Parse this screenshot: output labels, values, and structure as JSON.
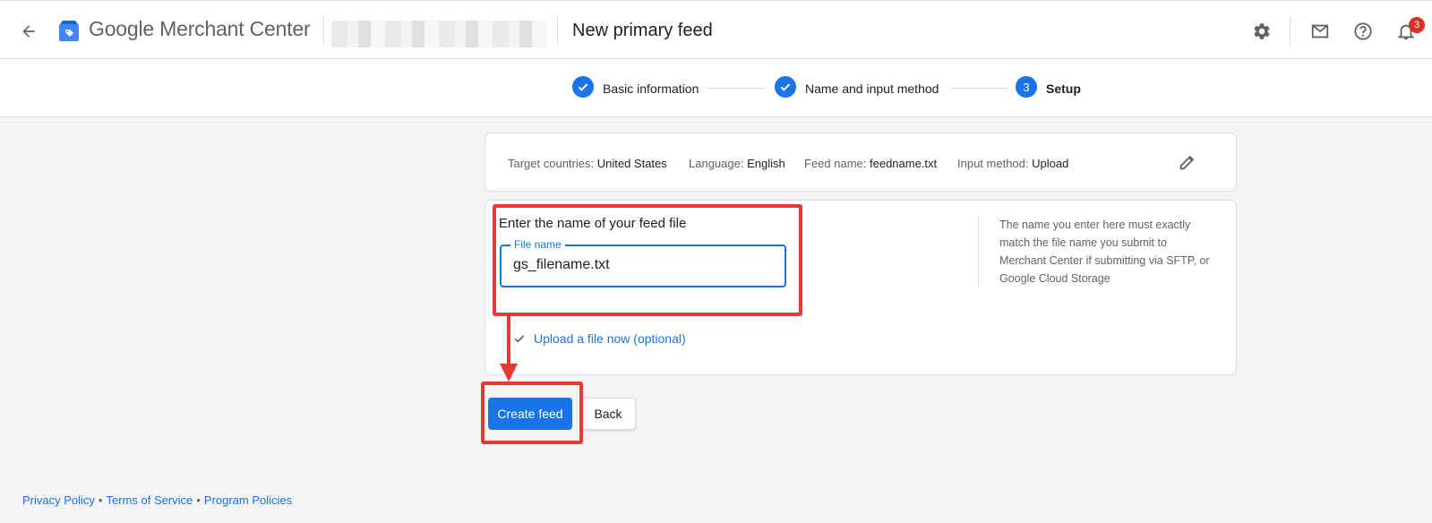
{
  "header": {
    "brand_google": "Google",
    "brand_product": "Merchant Center",
    "page_title": "New primary feed",
    "notification_count": "3",
    "icons": [
      "arrow-back-icon",
      "merchant-center-logo",
      "gear-icon",
      "mail-icon",
      "help-icon",
      "bell-icon"
    ]
  },
  "stepper": {
    "steps": [
      {
        "label": "Basic information",
        "state": "complete"
      },
      {
        "label": "Name and input method",
        "state": "complete"
      },
      {
        "label": "Setup",
        "state": "current",
        "number": "3"
      }
    ]
  },
  "summary": {
    "countries_key": "Target countries:",
    "countries_val": "United States",
    "language_key": "Language:",
    "language_val": "English",
    "feedname_key": "Feed name:",
    "feedname_val": "feedname.txt",
    "method_key": "Input method:",
    "method_val": "Upload"
  },
  "form": {
    "heading": "Enter the name of your feed file",
    "field_label": "File name",
    "field_value": "gs_filename.txt",
    "help_text": "The name you enter here must exactly match the file name you submit to Merchant Center if submitting via SFTP, or Google Cloud Storage",
    "upload_link": "Upload a file now (optional)"
  },
  "actions": {
    "primary": "Create feed",
    "secondary": "Back"
  },
  "footer": {
    "privacy": "Privacy Policy",
    "terms": "Terms of Service",
    "program": "Program Policies"
  },
  "colors": {
    "accent": "#1a73e8",
    "annotation": "#e53935",
    "badge": "#d93025",
    "background": "#f4f4f4"
  }
}
